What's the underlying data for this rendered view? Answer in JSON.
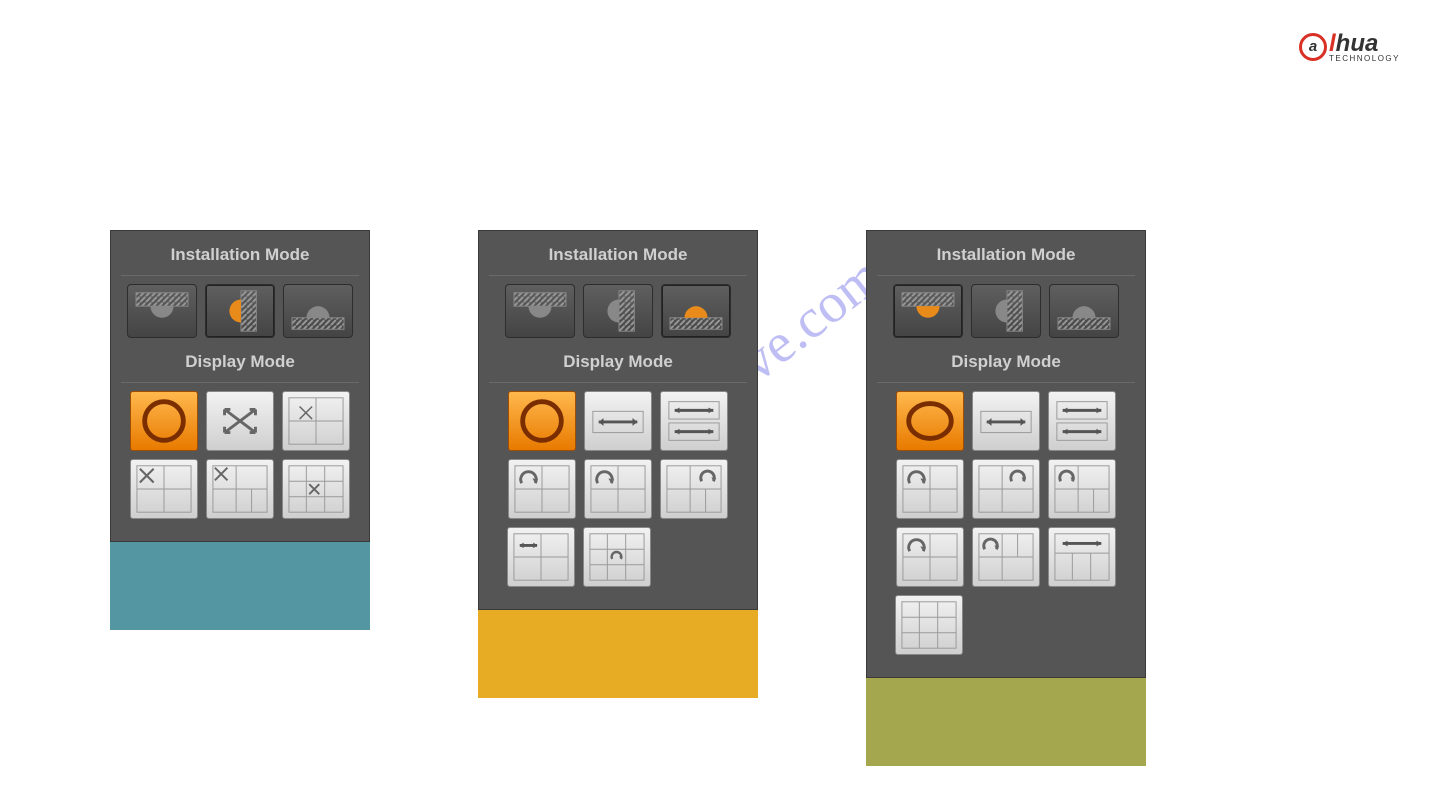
{
  "brand": {
    "name_part1": "a",
    "name_part2": "lhua",
    "subtitle": "TECHNOLOGY"
  },
  "watermark_text": "manualshive.com",
  "panels": {
    "wall": {
      "install_title": "Installation Mode",
      "display_title": "Display Mode",
      "caption_color": "#5596a3"
    },
    "ground": {
      "install_title": "Installation Mode",
      "display_title": "Display Mode",
      "caption_color": "#e8ac24"
    },
    "ceiling": {
      "install_title": "Installation Mode",
      "display_title": "Display Mode",
      "caption_color": "#a4a74e"
    }
  }
}
